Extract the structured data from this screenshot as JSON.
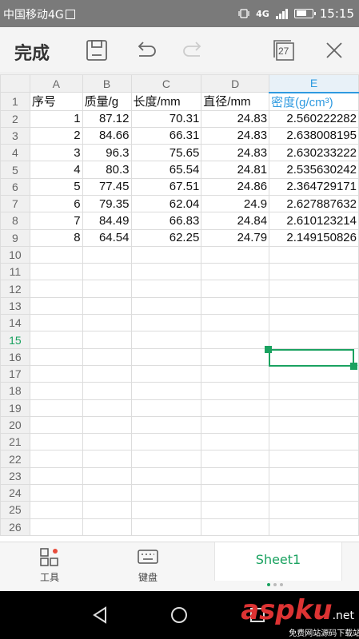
{
  "status_bar": {
    "carrier": "中国移动4G",
    "network": "4G",
    "time": "15:15"
  },
  "toolbar": {
    "done_label": "完成",
    "pages_count": "27"
  },
  "grid": {
    "columns": [
      "A",
      "B",
      "C",
      "D",
      "E"
    ],
    "header_row": [
      "序号",
      "质量/g",
      "长度/mm",
      "直径/mm",
      "密度(g/cm³)"
    ],
    "rows": [
      [
        "1",
        "87.12",
        "70.31",
        "24.83",
        "2.560222282"
      ],
      [
        "2",
        "84.66",
        "66.31",
        "24.83",
        "2.638008195"
      ],
      [
        "3",
        "96.3",
        "75.65",
        "24.83",
        "2.630233222"
      ],
      [
        "4",
        "80.3",
        "65.54",
        "24.81",
        "2.535630242"
      ],
      [
        "5",
        "77.45",
        "67.51",
        "24.86",
        "2.364729171"
      ],
      [
        "6",
        "79.35",
        "62.04",
        "24.9",
        "2.627887632"
      ],
      [
        "7",
        "84.49",
        "66.83",
        "24.84",
        "2.610123214"
      ],
      [
        "8",
        "64.54",
        "62.25",
        "24.79",
        "2.149150826"
      ]
    ],
    "row_numbers": [
      "1",
      "2",
      "3",
      "4",
      "5",
      "6",
      "7",
      "8",
      "9",
      "10",
      "11",
      "12",
      "13",
      "14",
      "15",
      "16",
      "17",
      "18",
      "19",
      "20",
      "21",
      "22",
      "23",
      "24",
      "25",
      "26"
    ],
    "active_row": "15",
    "active_column": "E"
  },
  "bottom_bar": {
    "tools_label": "工具",
    "keyboard_label": "键盘",
    "sheet_tab": "Sheet1"
  },
  "watermark": {
    "brand": "aspku",
    "tagline": "免费网站源码下载站!",
    "suffix": ".net"
  },
  "colors": {
    "accent_green": "#1aa260",
    "accent_blue": "#2e9ae0",
    "notification_dot": "#e74c3c"
  }
}
